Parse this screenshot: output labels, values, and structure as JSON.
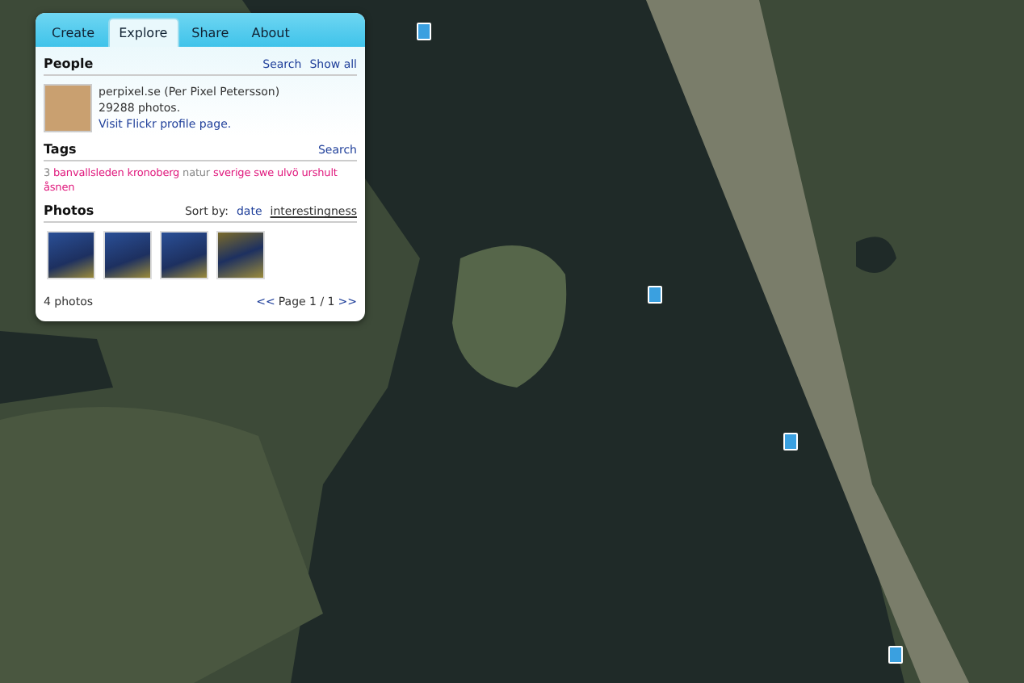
{
  "tabs": [
    {
      "label": "Create",
      "selected": false
    },
    {
      "label": "Explore",
      "selected": true
    },
    {
      "label": "Share",
      "selected": false
    },
    {
      "label": "About",
      "selected": false
    }
  ],
  "people": {
    "title": "People",
    "actions": [
      "Search",
      "Show all"
    ],
    "name": "perpixel.se (Per Pixel Petersson)",
    "photo_count": "29288 photos.",
    "profile_link": "Visit Flickr profile page."
  },
  "tags": {
    "title": "Tags",
    "action": "Search",
    "items": [
      {
        "label": "3",
        "color": "#888888"
      },
      {
        "label": "banvallsleden",
        "color": "#e0197d"
      },
      {
        "label": "kronoberg",
        "color": "#e0197d"
      },
      {
        "label": "natur",
        "color": "#888888"
      },
      {
        "label": "sverige",
        "color": "#e0197d"
      },
      {
        "label": "swe",
        "color": "#e0197d"
      },
      {
        "label": "ulvö",
        "color": "#e0197d"
      },
      {
        "label": "urshult",
        "color": "#e0197d"
      },
      {
        "label": "åsnen",
        "color": "#e0197d"
      }
    ]
  },
  "photos": {
    "title": "Photos",
    "sort_label": "Sort by:",
    "sort_options": [
      {
        "label": "date",
        "selected": false
      },
      {
        "label": "interestingness",
        "selected": true
      }
    ],
    "count": "4 photos",
    "prev": "<<",
    "page": "Page 1 / 1",
    "next": ">>",
    "thumbnails": [
      {
        "kind": "water"
      },
      {
        "kind": "water"
      },
      {
        "kind": "water"
      },
      {
        "kind": "land"
      }
    ]
  }
}
